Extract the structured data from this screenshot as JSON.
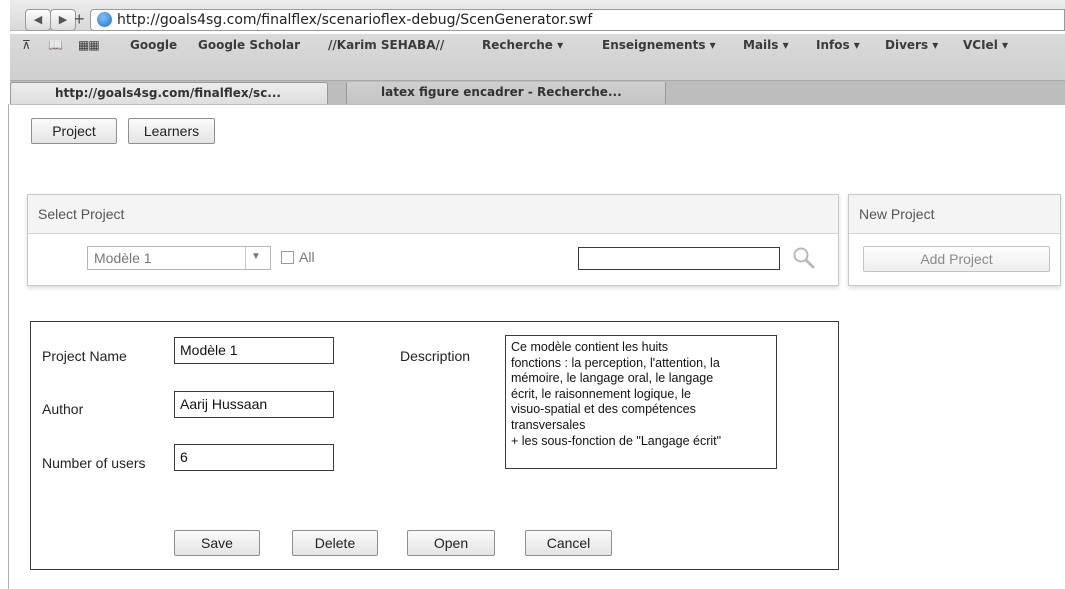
{
  "browser": {
    "url": "http://goals4sg.com/finalflex/scenarioflex-debug/ScenGenerator.swf",
    "bookmarks": [
      "Google",
      "Google Scholar",
      "//Karim SEHABA//",
      "Recherche ▾",
      "Enseignements ▾",
      "Mails ▾",
      "Infos ▾",
      "Divers ▾",
      "VCIel ▾"
    ],
    "tabs": [
      "http://goals4sg.com/finalflex/sc...",
      "latex figure encadrer - Recherche..."
    ]
  },
  "nav": {
    "project": "Project",
    "learners": "Learners"
  },
  "select_project": {
    "title": "Select Project",
    "dropdown_value": "Modèle 1",
    "all_label": "All",
    "search_value": ""
  },
  "new_project": {
    "title": "New Project",
    "add_button": "Add Project"
  },
  "form": {
    "project_name_label": "Project Name",
    "project_name_value": "Modèle 1",
    "author_label": "Author",
    "author_value": "Aarij Hussaan",
    "users_label": "Number of users",
    "users_value": "6",
    "description_label": "Description",
    "description_lines": [
      "Ce modèle contient les huits",
      "fonctions : la perception, l'attention, la",
      "mémoire, le langage oral, le langage",
      "écrit, le raisonnement logique, le",
      "visuo-spatial et des compétences",
      "transversales",
      "+ les sous-fonction de \"Langage écrit\""
    ],
    "buttons": {
      "save": "Save",
      "delete": "Delete",
      "open": "Open",
      "cancel": "Cancel"
    }
  },
  "icons": [
    "back-icon",
    "forward-icon",
    "plus-icon",
    "globe-icon",
    "reading-list-icon",
    "bookmarks-book-icon",
    "grid-icon",
    "dropdown-arrow-icon",
    "search-icon"
  ]
}
